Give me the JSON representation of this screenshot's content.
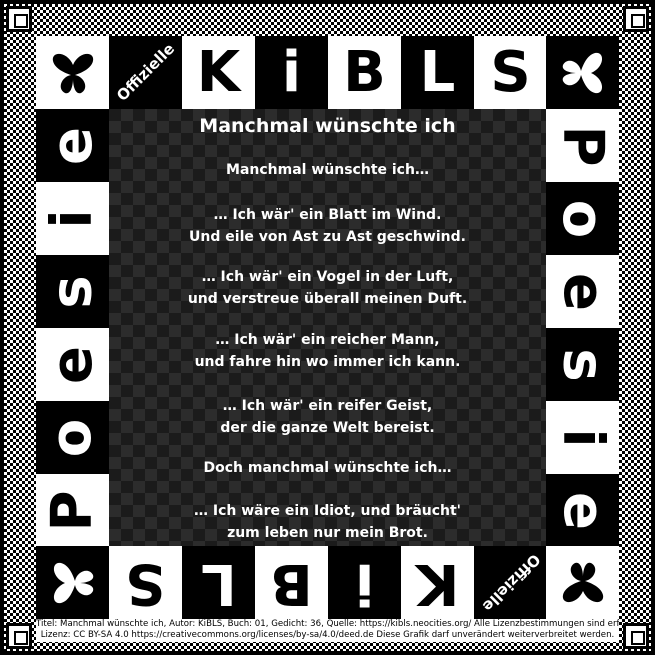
{
  "border": {
    "top_letters": [
      "K",
      "i",
      "B",
      "L",
      "S"
    ],
    "bottom_letters": [
      "K",
      "i",
      "B",
      "L",
      "S"
    ],
    "left_letters": [
      "P",
      "o",
      "e",
      "s",
      "i",
      "e"
    ],
    "right_letters": [
      "P",
      "o",
      "e",
      "s",
      "i",
      "e"
    ],
    "badge_top_left": "Offizielle",
    "badge_bottom_right": "Offizielle",
    "corner_icon": "butterfly-icon"
  },
  "poem": {
    "title": "Manchmal wünschte ich",
    "stanzas": [
      [
        "Manchmal wünschte ich…"
      ],
      [
        "… Ich wär' ein Blatt im Wind.",
        "Und eile von Ast zu Ast geschwind."
      ],
      [
        "… Ich wär' ein Vogel in der Luft,",
        "und verstreue überall meinen Duft."
      ],
      [
        "… Ich wär' ein reicher Mann,",
        "und fahre hin wo immer ich kann."
      ],
      [
        "… Ich wär' ein reifer Geist,",
        "der die ganze Welt bereist."
      ],
      [
        "Doch manchmal wünschte ich…"
      ],
      [
        "… Ich wäre ein Idiot, und bräucht'",
        "zum leben nur mein Brot."
      ]
    ]
  },
  "footer": {
    "line1": "Titel: Manchmal wünschte ich, Autor: KiBLS, Buch: 01, Gedicht: 36, Quelle: https://kibls.neocities.org/ Alle Lizenzbestimmungen sind erfüllt.",
    "line2": "Lizenz: CC BY-SA 4.0 https://creativecommons.org/licenses/by-sa/4.0/deed.de Diese Grafik darf unverändert weiterverbreitet werden."
  },
  "colors": {
    "black": "#000000",
    "white": "#ffffff",
    "center_checker_dark": "#1b1b1b",
    "center_checker_light": "#2c2c2c"
  }
}
